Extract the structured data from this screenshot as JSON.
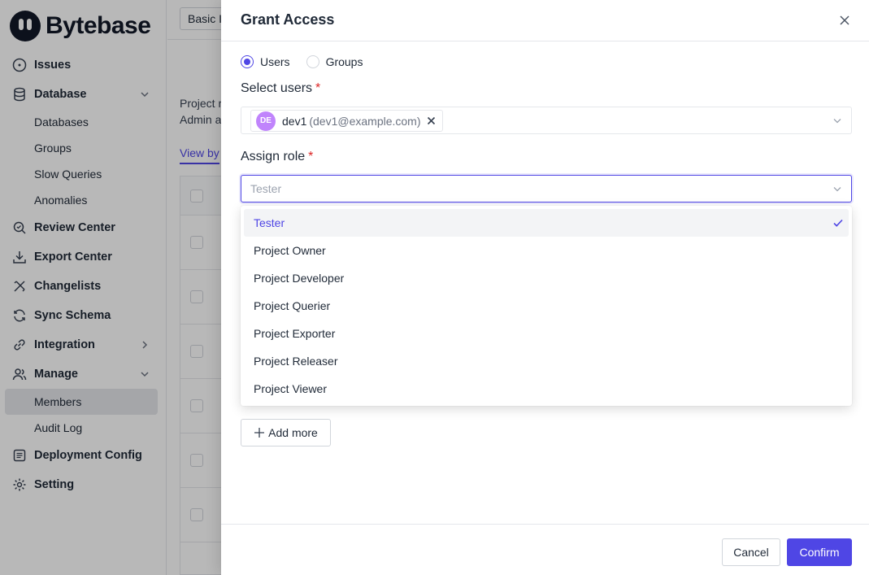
{
  "app": {
    "brand": "Bytebase"
  },
  "sidebar": {
    "items": [
      {
        "label": "Issues",
        "icon": "issues-icon"
      },
      {
        "label": "Database",
        "icon": "database-icon",
        "expanded": true,
        "children": [
          "Databases",
          "Groups",
          "Slow Queries",
          "Anomalies"
        ]
      },
      {
        "label": "Review Center",
        "icon": "review-icon"
      },
      {
        "label": "Export Center",
        "icon": "download-icon"
      },
      {
        "label": "Changelists",
        "icon": "changelist-icon"
      },
      {
        "label": "Sync Schema",
        "icon": "sync-icon"
      },
      {
        "label": "Integration",
        "icon": "link-icon",
        "expanded": false
      },
      {
        "label": "Manage",
        "icon": "users-icon",
        "expanded": true,
        "children": [
          "Members",
          "Audit Log"
        ],
        "active_child": "Members"
      },
      {
        "label": "Deployment Config",
        "icon": "config-icon"
      },
      {
        "label": "Setting",
        "icon": "gear-icon"
      }
    ]
  },
  "main": {
    "basic_button": "Basic I",
    "project_text_1": "Project r",
    "project_text_2": "Admin a",
    "view_by": "View by"
  },
  "drawer": {
    "title": "Grant Access",
    "type_options": [
      {
        "label": "Users",
        "checked": true
      },
      {
        "label": "Groups",
        "checked": false
      }
    ],
    "select_users_label": "Select users",
    "required_mark": "*",
    "selected_user": {
      "initials": "DE",
      "name": "dev1",
      "email": "(dev1@example.com)"
    },
    "assign_role_label": "Assign role",
    "role_placeholder": "Tester",
    "role_options": [
      "Tester",
      "Project Owner",
      "Project Developer",
      "Project Querier",
      "Project Exporter",
      "Project Releaser",
      "Project Viewer"
    ],
    "selected_role": "Tester",
    "add_more_label": "Add more",
    "cancel_label": "Cancel",
    "confirm_label": "Confirm"
  },
  "colors": {
    "accent": "#4f46e5",
    "avatar": "#c084fc",
    "required": "#dc2626"
  }
}
